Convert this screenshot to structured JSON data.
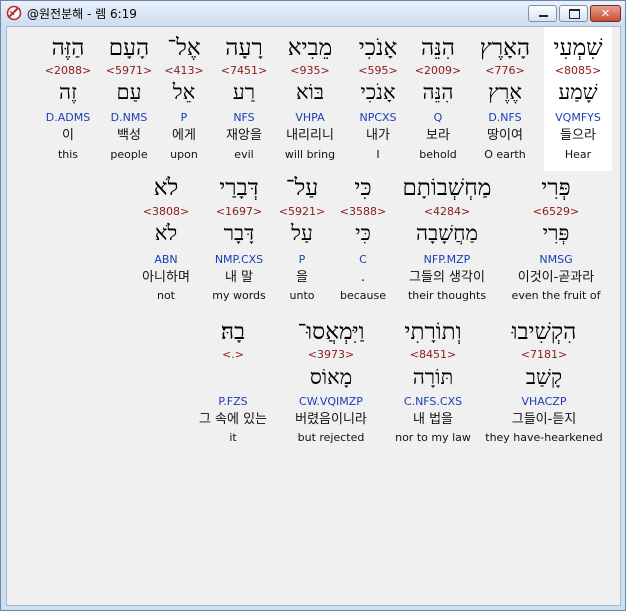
{
  "window": {
    "title": "@원전분해 - 렘 6:19",
    "icon": "bible-app-icon",
    "controls": {
      "minimize": "minimize",
      "maximize": "maximize",
      "close": "close"
    }
  },
  "rows": [
    {
      "words": [
        {
          "hebrew": "שִׁמְעִי",
          "strong": "<8085>",
          "lemma": "שָׁמַע",
          "morph": "VQMFYS",
          "korean": "들으라",
          "english": "Hear",
          "highlighted": true
        },
        {
          "hebrew": "הָאָרֶץ",
          "strong": "<776>",
          "lemma": "אֶרֶץ",
          "morph": "D.NFS",
          "korean": "땅이여",
          "english": "O earth"
        },
        {
          "hebrew": "הִנֵּה",
          "strong": "<2009>",
          "lemma": "הִנֵּה",
          "morph": "Q",
          "korean": "보라",
          "english": "behold"
        },
        {
          "hebrew": "אָנֹכִי",
          "strong": "<595>",
          "lemma": "אָנֹכִי",
          "morph": "NPCXS",
          "korean": "내가",
          "english": "I"
        },
        {
          "hebrew": "מֵבִיא",
          "strong": "<935>",
          "lemma": "בּוֹא",
          "morph": "VHPA",
          "korean": "내리리니",
          "english": "will bring"
        },
        {
          "hebrew": "רָעָה",
          "strong": "<7451>",
          "lemma": "רַע",
          "morph": "NFS",
          "korean": "재앙을",
          "english": "evil"
        },
        {
          "hebrew": "אֶל־",
          "strong": "<413>",
          "lemma": "אֵל",
          "morph": "P",
          "korean": "에게",
          "english": "upon"
        },
        {
          "hebrew": "הָעָם",
          "strong": "<5971>",
          "lemma": "עַם",
          "morph": "D.NMS",
          "korean": "백성",
          "english": "people"
        },
        {
          "hebrew": "הַזֶּה",
          "strong": "<2088>",
          "lemma": "זֶה",
          "morph": "D.ADMS",
          "korean": "이",
          "english": "this"
        }
      ]
    },
    {
      "words": [
        {
          "hebrew": "פְּרִי",
          "strong": "<6529>",
          "lemma": "פְּרִי",
          "morph": "NMSG",
          "korean": "이것이-곧과라",
          "english": "even the fruit of"
        },
        {
          "hebrew": "מַחְשְׁבוֹתָם",
          "strong": "<4284>",
          "lemma": "מַחֲשָׁבָה",
          "morph": "NFP.MZP",
          "korean": "그들의 생각이",
          "english": "their thoughts"
        },
        {
          "hebrew": "כִּי",
          "strong": "<3588>",
          "lemma": "כִּי",
          "morph": "C",
          "korean": ".",
          "english": "because"
        },
        {
          "hebrew": "עַל־",
          "strong": "<5921>",
          "lemma": "עַל",
          "morph": "P",
          "korean": "을",
          "english": "unto"
        },
        {
          "hebrew": "דְּבָרַי",
          "strong": "<1697>",
          "lemma": "דָּבָר",
          "morph": "NMP.CXS",
          "korean": "내 말",
          "english": "my words"
        },
        {
          "hebrew": "לֹא",
          "strong": "<3808>",
          "lemma": "לֹא",
          "morph": "ABN",
          "korean": "아니하며",
          "english": "not"
        }
      ]
    },
    {
      "words": [
        {
          "hebrew": "הִקְשִׁיבוּ",
          "strong": "<7181>",
          "lemma": "קָשַׁב",
          "morph": "VHACZP",
          "korean": "그들이-듣지",
          "english": "they have-hearkened"
        },
        {
          "hebrew": "וְתוֹרָתִי",
          "strong": "<8451>",
          "lemma": "תּוֹרָה",
          "morph": "C.NFS.CXS",
          "korean": "내 법을",
          "english": "nor to my law"
        },
        {
          "hebrew": "וַיִּמְאֲסוּ־",
          "strong": "<3973>",
          "lemma": "מָאוֹס",
          "morph": "CW.VQIMZP",
          "korean": "버렸음이니라",
          "english": "but rejected"
        },
        {
          "hebrew": "בָהּ׃",
          "strong": "<.>",
          "lemma": "",
          "morph": "P.FZS",
          "korean": "그 속에 있는",
          "english": "it"
        }
      ]
    }
  ],
  "colors": {
    "strong": "#8b1a1a",
    "morph": "#1b3db8",
    "highlight": "#ffffff"
  }
}
